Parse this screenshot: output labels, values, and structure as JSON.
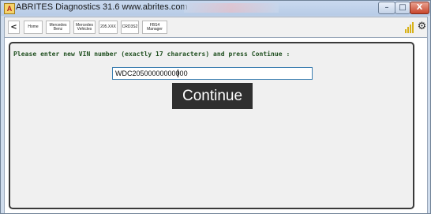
{
  "window": {
    "app_icon_letter": "A",
    "title": "ABRITES Diagnostics 31.6   www.abrites.com",
    "minimize_icon": "minimize-icon",
    "maximize_icon": "maximize-icon",
    "close_icon": "close-icon",
    "minimize_glyph": "–",
    "maximize_glyph": "□",
    "close_glyph": "X"
  },
  "toolbar": {
    "back_glyph": "<",
    "tabs": [
      {
        "label": "Home"
      },
      {
        "label": "Mercedes\nBenz"
      },
      {
        "label": "Mercedes\nVehicles"
      },
      {
        "label": "205.XXX"
      },
      {
        "label": "CRD3S2"
      },
      {
        "label": "FBS4 Manager"
      }
    ],
    "signal_icon": "signal-bars-icon",
    "gear_icon": "gear-icon",
    "gear_glyph": "⚙",
    "signal_color": "#d8b21a"
  },
  "main": {
    "prompt": "Please enter new VIN number (exactly 17 characters) and press Continue :",
    "vin_value": "WDC20500000000000",
    "continue_label": "Continue"
  },
  "colors": {
    "panel_bg": "#f0f0f0",
    "prompt_text": "#1f4f1f",
    "button_bg": "#2f2f2f",
    "input_border": "#3c7fb1"
  }
}
